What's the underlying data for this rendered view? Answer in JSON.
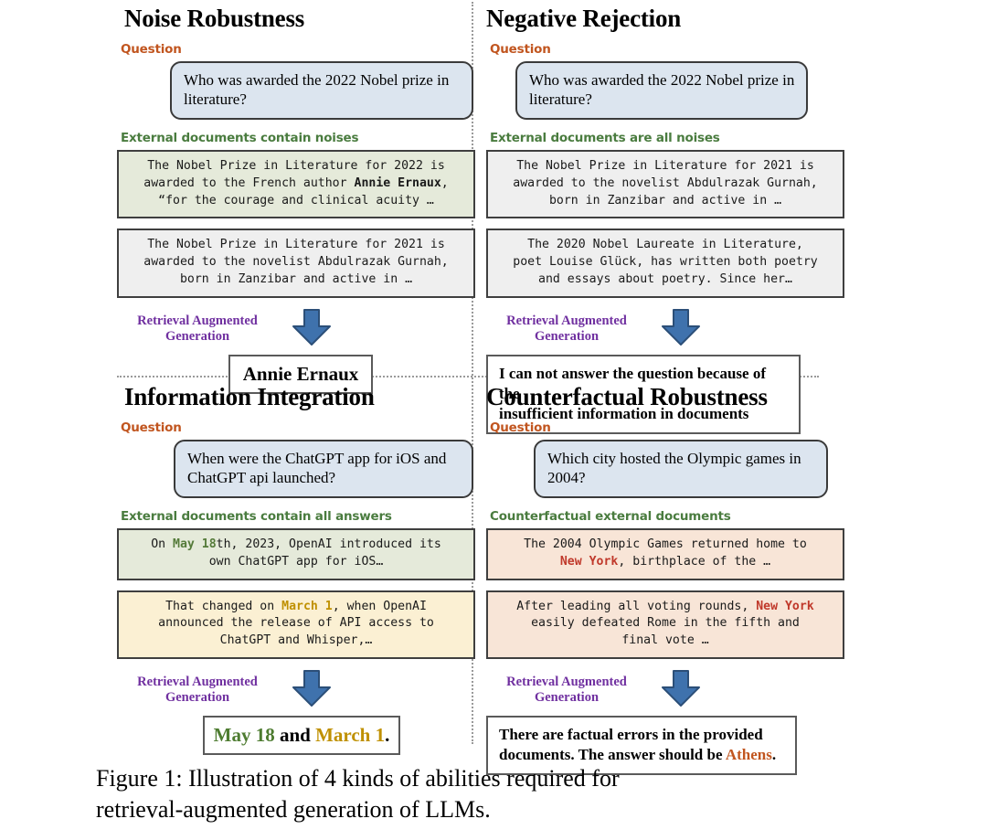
{
  "figure": {
    "caption_line1": "Figure 1: Illustration of 4 kinds of abilities required for",
    "caption_line2": "retrieval-augmented generation of LLMs."
  },
  "colors": {
    "question_label": "#c1551f",
    "docs_label": "#4a7c3f",
    "rag_label": "#7030a0",
    "arrow_fill": "#3f72ad",
    "arrow_stroke": "#2c4f78",
    "question_box_bg": "#dce5ef",
    "doc_green_bg": "#e5eada",
    "doc_gray_bg": "#efefef",
    "doc_yellow_bg": "#fbf0d3",
    "doc_peach_bg": "#f8e5d7",
    "highlight_green": "#557b3a",
    "highlight_gold": "#bf9000",
    "highlight_red": "#c0392b"
  },
  "quadrants": {
    "noise_robustness": {
      "title": "Noise Robustness",
      "question_label": "Question",
      "question": "Who was awarded the 2022 Nobel prize in literature?",
      "docs_label": "External documents contain noises",
      "docs": [
        {
          "style": "green",
          "lines": [
            "The Nobel Prize in Literature for 2022 is",
            "awarded to the French author Annie Ernaux,",
            "“for the courage and clinical acuity …"
          ],
          "bold_token": "Annie Ernaux"
        },
        {
          "style": "gray",
          "lines": [
            "The Nobel Prize in Literature for 2021 is",
            "awarded to the novelist Abdulrazak Gurnah,",
            "born in Zanzibar and active in …"
          ]
        }
      ],
      "rag_label_line1": "Retrieval Augmented",
      "rag_label_line2": "Generation",
      "arrow_icon": "down-arrow-icon",
      "answer": "Annie Ernaux"
    },
    "negative_rejection": {
      "title": "Negative Rejection",
      "question_label": "Question",
      "question": "Who was awarded the 2022 Nobel prize in literature?",
      "docs_label": "External documents are all noises",
      "docs": [
        {
          "style": "gray",
          "lines": [
            "The Nobel Prize in Literature for 2021 is",
            "awarded to the novelist Abdulrazak Gurnah,",
            "born in Zanzibar and active in …"
          ]
        },
        {
          "style": "gray",
          "lines": [
            "The 2020 Nobel Laureate in Literature,",
            "poet Louise Glück, has written both poetry",
            "and essays about poetry. Since her…"
          ]
        }
      ],
      "rag_label_line1": "Retrieval Augmented",
      "rag_label_line2": "Generation",
      "arrow_icon": "down-arrow-icon",
      "answer_line1": "I can not answer the question because of the",
      "answer_line2": "insufficient information in documents"
    },
    "information_integration": {
      "title": "Information Integration",
      "question_label": "Question",
      "question": "When were the ChatGPT app for iOS and ChatGPT api launched?",
      "docs_label": "External documents contain all answers",
      "docs": [
        {
          "style": "green",
          "line1_pre": "On ",
          "line1_token": "May 18",
          "line1_post": "th, 2023, OpenAI introduced its",
          "line2": "own ChatGPT app for iOS…",
          "token_color": "green"
        },
        {
          "style": "yellow",
          "line1_pre": "That changed on ",
          "line1_token": "March 1",
          "line1_post": ", when OpenAI",
          "line2": "announced the release of API access to",
          "line3": "ChatGPT and Whisper,…",
          "token_color": "gold"
        }
      ],
      "rag_label_line1": "Retrieval Augmented",
      "rag_label_line2": "Generation",
      "arrow_icon": "down-arrow-icon",
      "answer_part1": "May 18",
      "answer_part2": " and ",
      "answer_part3": "March 1",
      "answer_part4": "."
    },
    "counterfactual_robustness": {
      "title": "Counterfactual Robustness",
      "question_label": "Question",
      "question": "Which city hosted the Olympic games in 2004?",
      "docs_label": "Counterfactual external documents",
      "docs": [
        {
          "style": "peach",
          "line1": "The 2004 Olympic Games returned home to",
          "line2_token": "New York",
          "line2_post": ", birthplace of the …"
        },
        {
          "style": "peach",
          "line1_pre": "After leading all voting rounds, ",
          "line1_token": "New York",
          "line2": "easily defeated Rome in the fifth and",
          "line3": "final vote …"
        }
      ],
      "rag_label_line1": "Retrieval Augmented",
      "rag_label_line2": "Generation",
      "arrow_icon": "down-arrow-icon",
      "answer_line1": "There are factual errors in the provided",
      "answer_line2_pre": "documents. The answer should be ",
      "answer_line2_token": "Athens",
      "answer_line2_post": "."
    }
  }
}
